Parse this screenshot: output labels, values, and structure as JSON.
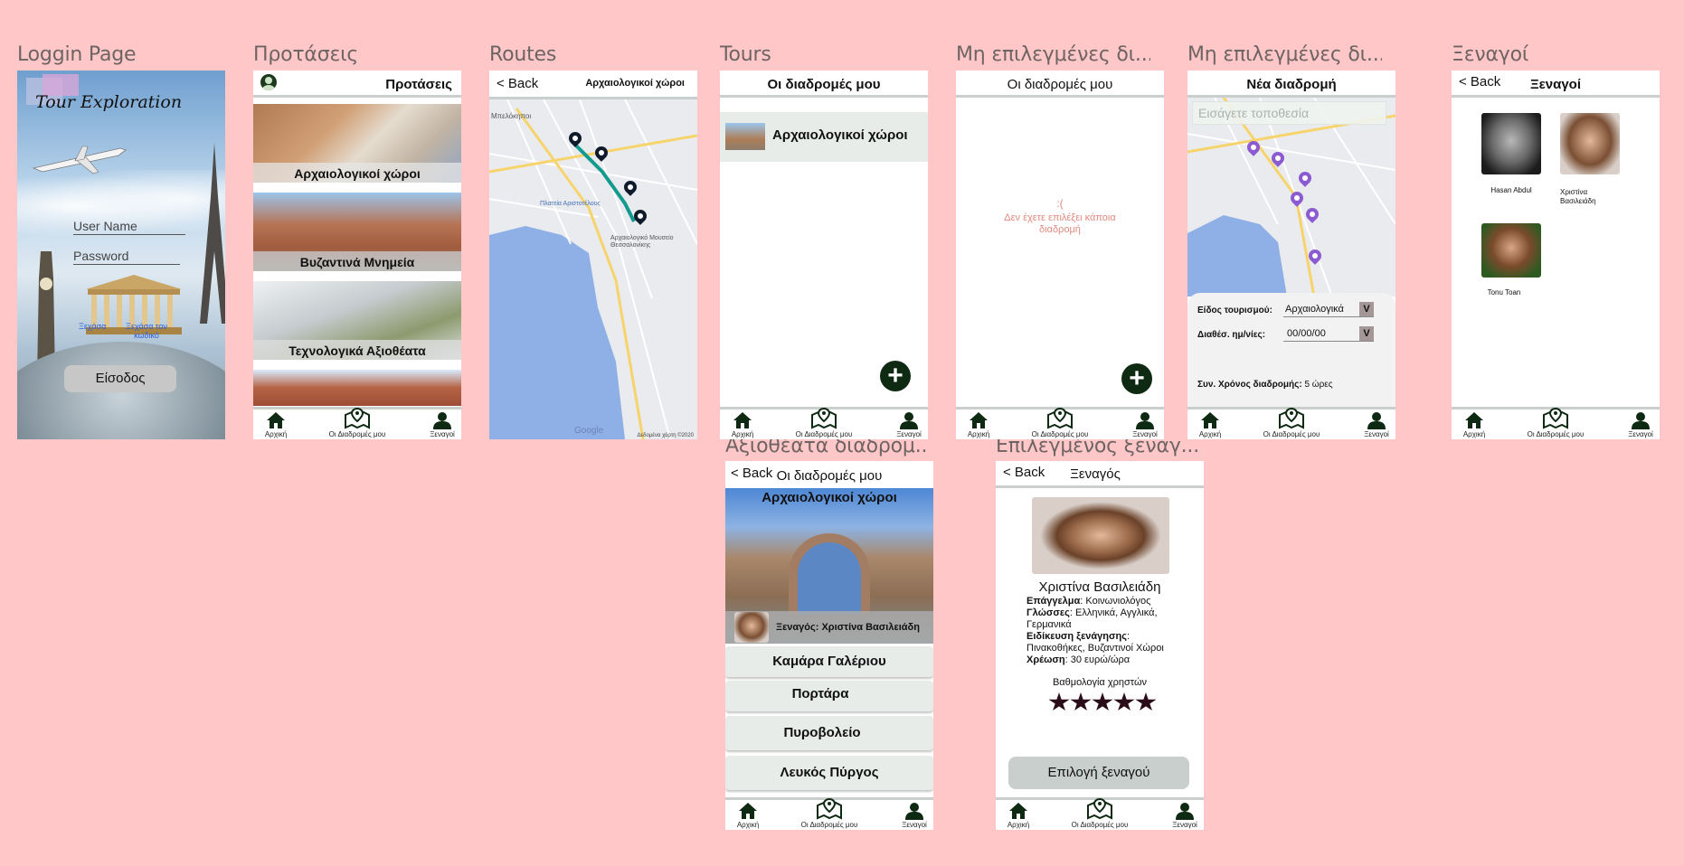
{
  "frames": {
    "login": {
      "title": "Loggin Page",
      "brand": "Tour Exploration",
      "username_placeholder": "User Name",
      "password_placeholder": "Password",
      "forgot_left": "Ξεχάσα",
      "forgot_right": "Ξεχάσα τον κωδικό",
      "submit": "Είσοδος"
    },
    "proposals": {
      "title": "Προτάσεις",
      "header": "Προτάσεις",
      "cards": [
        "Αρχαιολογικοί χώροι",
        "Βυζαντινά Μνημεία",
        "Τεχνολογικά Αξιοθέατα"
      ]
    },
    "routes": {
      "title": "Routes",
      "back": "< Back",
      "header": "Αρχαιολογικοί χώροι",
      "map_labels": {
        "neighborhood": "Μπελόκηποι",
        "square": "Πλατεία Αριστοτέλους",
        "museum": "Αρχαιολογικό Μουσείο Θεσσαλονίκης",
        "google": "Google",
        "copyright": "Δεδομένα χάρτη ©2020"
      }
    },
    "tours": {
      "title": "Tours",
      "header": "Οι διαδρομές μου",
      "items": [
        "Αρχαιολογικοί χώροι"
      ]
    },
    "unselected": {
      "title": "Μη επιλεγμένες δι...",
      "header": "Οι διαδρομές μου",
      "sad": ":(",
      "message": "Δεν έχετε επιλέξει κάποια διαδρομή"
    },
    "new_route": {
      "title": "Μη επιλεγμένες δι...",
      "header": "Νέα διαδρομή",
      "location_placeholder": "Εισάγετε τοποθεσία",
      "tourism_type_label": "Είδος τουρισμού:",
      "tourism_type_value": "Αρχαιολογικά",
      "availability_label": "Διαθέσ. ημ/νίες:",
      "availability_value": "00/00/00",
      "total_time_label": "Συν. Χρόνος διαδρομής:",
      "total_time_value": "5 ώρες",
      "dropdown_glyph": "V"
    },
    "guides": {
      "title": "Ξεναγοί",
      "back": "< Back",
      "header": "Ξεναγοί",
      "people": [
        "Hasan Abdul",
        "Χριστίνα Βασιλειάδη",
        "Tonu Toan"
      ]
    },
    "sights": {
      "title": "Αξιοθέατα διαδρομ...",
      "back": "< Back",
      "header": "Οι διαδρομές μου",
      "banner_title": "Αρχαιολογικοί χώροι",
      "guide_caption": "Ξεναγός: Χριστίνα Βασιλειάδη",
      "items": [
        "Καμάρα Γαλέριου",
        "Πορτάρα",
        "Πυροβολείο",
        "Λευκός Πύργος"
      ]
    },
    "guide_detail": {
      "title": "Επιλεγμένος ξεναγ...",
      "back": "< Back",
      "header": "Ξεναγός",
      "name": "Χριστίνα Βασιλειάδη",
      "profession_label": "Επάγγελμα",
      "profession_value": ": Κοινωνιολόγος",
      "languages_label": "Γλώσσες",
      "languages_value": ": Ελληνικά, Αγγλικά, Γερμανικά",
      "specialty_label": "Ειδίκευση ξενάγησης",
      "specialty_value": ": Πινακοθήκες, Βυζαντινοί Χώροι",
      "fee_label": "Χρέωση",
      "fee_value": ": 30 ευρώ/ώρα",
      "rating_label": "Βαθμολογία χρηστών",
      "rating": 5,
      "rating_max": 5,
      "select_button": "Επιλογή ξεναγού"
    }
  },
  "nav": {
    "home": "Αρχική",
    "routes": "Οι Διαδρομές μου",
    "guides": "Ξεναγοί",
    "home_alt": "Αρχική"
  },
  "colors": {
    "background": "#ffc7c7",
    "dark_green": "#0e2a12",
    "route_teal": "#129a8f",
    "pin_purple": "#8c5bd1",
    "sea": "#8fb0e6",
    "error_text": "#e2897d"
  },
  "icons": [
    "home-icon",
    "map-pin-icon",
    "user-icon",
    "plus-icon",
    "back-icon",
    "star-icon"
  ]
}
